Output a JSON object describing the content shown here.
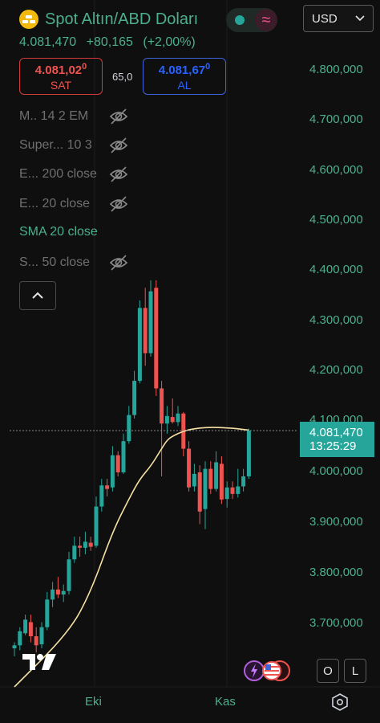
{
  "header": {
    "title": "Spot Altın/ABD Doları",
    "currency": "USD",
    "price": "4.081,470",
    "change_abs": "+80,165",
    "change_pct": "(+2,00%)",
    "colors": {
      "up": "#26a69a",
      "down": "#ef5350",
      "accent": "#4caf8f"
    }
  },
  "trade": {
    "sell_price": "4.081,02",
    "sell_price_sup": "0",
    "sell_label": "SAT",
    "spread": "65,0",
    "buy_price": "4.081,67",
    "buy_price_sup": "0",
    "buy_label": "AL"
  },
  "indicators": [
    {
      "label": "M.. 14 2 EM",
      "visible": false
    },
    {
      "label": "Super... 10 3",
      "visible": false
    },
    {
      "label": "E... 200 close",
      "visible": false
    },
    {
      "label": "E... 20 close",
      "visible": false
    },
    {
      "label": "SMA 20 close",
      "visible": true
    },
    {
      "label": "S... 50 close",
      "visible": false
    }
  ],
  "price_axis": [
    "4.800,000",
    "4.700,000",
    "4.600,000",
    "4.500,000",
    "4.400,000",
    "4.300,000",
    "4.200,000",
    "4.100,000",
    "4.000,000",
    "3.900,000",
    "3.800,000",
    "3.700,000"
  ],
  "last_price": {
    "value": "4.081,470",
    "countdown": "13:25:29"
  },
  "time_axis": [
    "Eki",
    "Kas"
  ],
  "buttons": {
    "o": "O",
    "l": "L"
  },
  "chart_data": {
    "type": "candlestick",
    "ylim": [
      3630,
      4880
    ],
    "candles": [
      {
        "o": 3648,
        "h": 3660,
        "l": 3632,
        "c": 3654
      },
      {
        "o": 3654,
        "h": 3690,
        "l": 3644,
        "c": 3682
      },
      {
        "o": 3678,
        "h": 3715,
        "l": 3674,
        "c": 3705
      },
      {
        "o": 3700,
        "h": 3715,
        "l": 3660,
        "c": 3672
      },
      {
        "o": 3672,
        "h": 3690,
        "l": 3640,
        "c": 3654
      },
      {
        "o": 3656,
        "h": 3700,
        "l": 3648,
        "c": 3690
      },
      {
        "o": 3690,
        "h": 3760,
        "l": 3684,
        "c": 3745
      },
      {
        "o": 3745,
        "h": 3780,
        "l": 3730,
        "c": 3765
      },
      {
        "o": 3765,
        "h": 3790,
        "l": 3748,
        "c": 3755
      },
      {
        "o": 3755,
        "h": 3775,
        "l": 3740,
        "c": 3762
      },
      {
        "o": 3762,
        "h": 3840,
        "l": 3755,
        "c": 3825
      },
      {
        "o": 3825,
        "h": 3870,
        "l": 3818,
        "c": 3852
      },
      {
        "o": 3852,
        "h": 3870,
        "l": 3830,
        "c": 3848
      },
      {
        "o": 3848,
        "h": 3880,
        "l": 3835,
        "c": 3860
      },
      {
        "o": 3858,
        "h": 3870,
        "l": 3842,
        "c": 3850
      },
      {
        "o": 3852,
        "h": 3950,
        "l": 3848,
        "c": 3930
      },
      {
        "o": 3930,
        "h": 3985,
        "l": 3920,
        "c": 3972
      },
      {
        "o": 3972,
        "h": 3985,
        "l": 3950,
        "c": 3965
      },
      {
        "o": 3968,
        "h": 4050,
        "l": 3960,
        "c": 4032
      },
      {
        "o": 4032,
        "h": 4040,
        "l": 3990,
        "c": 3998
      },
      {
        "o": 3998,
        "h": 4075,
        "l": 3995,
        "c": 4060
      },
      {
        "o": 4060,
        "h": 4130,
        "l": 4055,
        "c": 4112
      },
      {
        "o": 4112,
        "h": 4200,
        "l": 4105,
        "c": 4180
      },
      {
        "o": 4180,
        "h": 4340,
        "l": 4175,
        "c": 4325
      },
      {
        "o": 4325,
        "h": 4365,
        "l": 4210,
        "c": 4235
      },
      {
        "o": 4235,
        "h": 4380,
        "l": 4228,
        "c": 4358
      },
      {
        "o": 4365,
        "h": 4380,
        "l": 4150,
        "c": 4165
      },
      {
        "o": 4165,
        "h": 4180,
        "l": 3990,
        "c": 4095
      },
      {
        "o": 4095,
        "h": 4130,
        "l": 4075,
        "c": 4110
      },
      {
        "o": 4108,
        "h": 4145,
        "l": 4095,
        "c": 4098
      },
      {
        "o": 4098,
        "h": 4130,
        "l": 4090,
        "c": 4115
      },
      {
        "o": 4115,
        "h": 4118,
        "l": 4030,
        "c": 4045
      },
      {
        "o": 4045,
        "h": 4060,
        "l": 3960,
        "c": 3968
      },
      {
        "o": 3970,
        "h": 4015,
        "l": 3960,
        "c": 3995
      },
      {
        "o": 3998,
        "h": 4012,
        "l": 3895,
        "c": 3920
      },
      {
        "o": 3925,
        "h": 4020,
        "l": 3885,
        "c": 4005
      },
      {
        "o": 4005,
        "h": 4020,
        "l": 3955,
        "c": 3965
      },
      {
        "o": 3965,
        "h": 4040,
        "l": 3960,
        "c": 4018
      },
      {
        "o": 4015,
        "h": 4030,
        "l": 3935,
        "c": 3944
      },
      {
        "o": 3945,
        "h": 3980,
        "l": 3928,
        "c": 3968
      },
      {
        "o": 3968,
        "h": 3980,
        "l": 3945,
        "c": 3955
      },
      {
        "o": 3955,
        "h": 4005,
        "l": 3948,
        "c": 3970
      },
      {
        "o": 3970,
        "h": 4005,
        "l": 3960,
        "c": 3990
      },
      {
        "o": 3990,
        "h": 4085,
        "l": 3985,
        "c": 4081
      }
    ],
    "sma20": [
      [
        0,
        3560
      ],
      [
        10,
        3680
      ],
      [
        14,
        3760
      ],
      [
        18,
        3880
      ],
      [
        21,
        3945
      ],
      [
        23,
        3985
      ],
      [
        25,
        4010
      ],
      [
        27,
        4045
      ],
      [
        28,
        4062
      ],
      [
        29,
        4070
      ],
      [
        31,
        4080
      ],
      [
        33,
        4085
      ],
      [
        36,
        4088
      ],
      [
        40,
        4086
      ],
      [
        43,
        4082
      ]
    ]
  }
}
